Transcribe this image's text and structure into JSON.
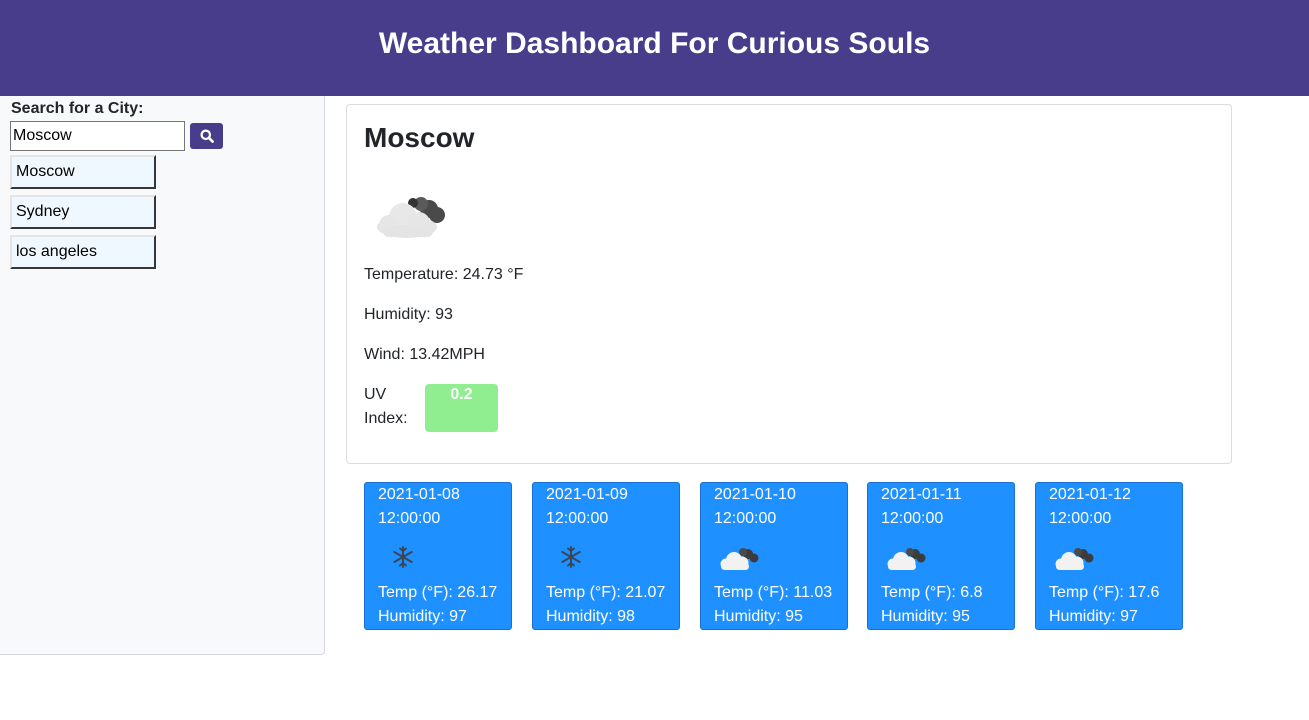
{
  "header": {
    "title": "Weather Dashboard For Curious Souls"
  },
  "search": {
    "label": "Search for a City:",
    "value": "Moscow",
    "button_icon": "search-icon"
  },
  "history": [
    {
      "label": "Moscow"
    },
    {
      "label": "Sydney"
    },
    {
      "label": "los angeles"
    }
  ],
  "current": {
    "city": "Moscow",
    "icon": "cloudy-icon",
    "temperature": "Temperature: 24.73 °F",
    "humidity": "Humidity: 93",
    "wind": "Wind: 13.42MPH",
    "uv_label": "UV Index:",
    "uv_value": "0.2",
    "uv_color": "#90ee90"
  },
  "forecast": [
    {
      "date": "2021-01-08",
      "time": "12:00:00",
      "icon": "snowflake-icon",
      "temp": "Temp (°F): 26.17",
      "humidity": "Humidity: 97"
    },
    {
      "date": "2021-01-09",
      "time": "12:00:00",
      "icon": "snowflake-icon",
      "temp": "Temp (°F): 21.07",
      "humidity": "Humidity: 98"
    },
    {
      "date": "2021-01-10",
      "time": "12:00:00",
      "icon": "cloudy-icon",
      "temp": "Temp (°F): 11.03",
      "humidity": "Humidity: 95"
    },
    {
      "date": "2021-01-11",
      "time": "12:00:00",
      "icon": "cloudy-icon",
      "temp": "Temp (°F): 6.8",
      "humidity": "Humidity: 95"
    },
    {
      "date": "2021-01-12",
      "time": "12:00:00",
      "icon": "cloudy-icon",
      "temp": "Temp (°F): 17.6",
      "humidity": "Humidity: 97"
    }
  ],
  "colors": {
    "header_bg": "#483d8b",
    "forecast_bg": "#1e90ff",
    "history_bg": "#f0f8ff"
  }
}
